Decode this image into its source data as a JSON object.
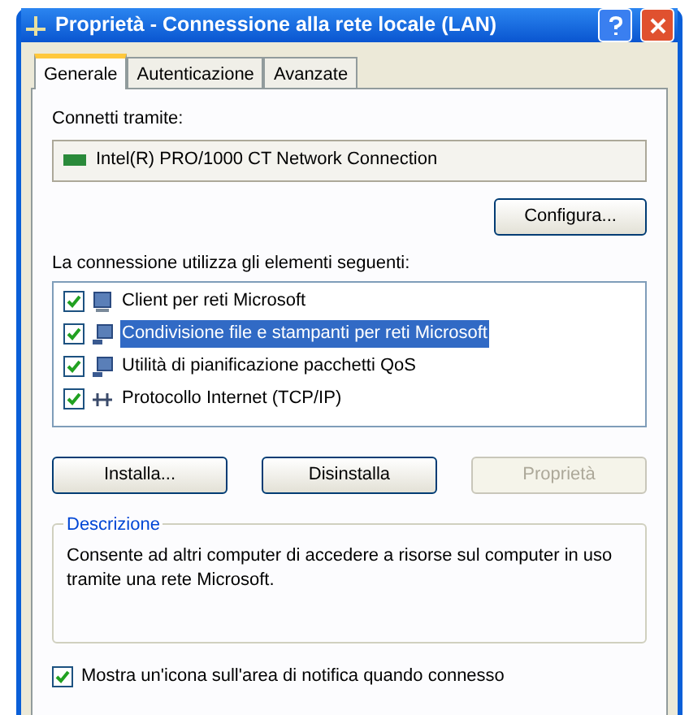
{
  "window": {
    "title": "Proprietà - Connessione alla rete locale (LAN)"
  },
  "tabs": [
    {
      "label": "Generale",
      "selected": true
    },
    {
      "label": "Autenticazione",
      "selected": false
    },
    {
      "label": "Avanzate",
      "selected": false
    }
  ],
  "connect_via": {
    "label": "Connetti tramite:",
    "adapter": "Intel(R) PRO/1000 CT Network Connection",
    "button": "Configura..."
  },
  "components": {
    "label": "La connessione utilizza gli elementi seguenti:",
    "items": [
      {
        "label": "Client per reti Microsoft",
        "checked": true,
        "selected": false,
        "kind": "client"
      },
      {
        "label": "Condivisione file e stampanti per reti Microsoft",
        "checked": true,
        "selected": true,
        "kind": "service"
      },
      {
        "label": "Utilità di pianificazione pacchetti QoS",
        "checked": true,
        "selected": false,
        "kind": "service"
      },
      {
        "label": "Protocollo Internet (TCP/IP)",
        "checked": true,
        "selected": false,
        "kind": "protocol"
      }
    ]
  },
  "buttons": [
    {
      "label": "Installa...",
      "disabled": false
    },
    {
      "label": "Disinstalla",
      "disabled": false
    },
    {
      "label": "Proprietà",
      "disabled": true
    }
  ],
  "description": {
    "title": "Descrizione",
    "text": "Consente ad altri computer di accedere a risorse sul computer in uso tramite una rete Microsoft."
  },
  "notify": {
    "label": "Mostra un'icona sull'area di notifica quando connesso",
    "checked": true
  }
}
